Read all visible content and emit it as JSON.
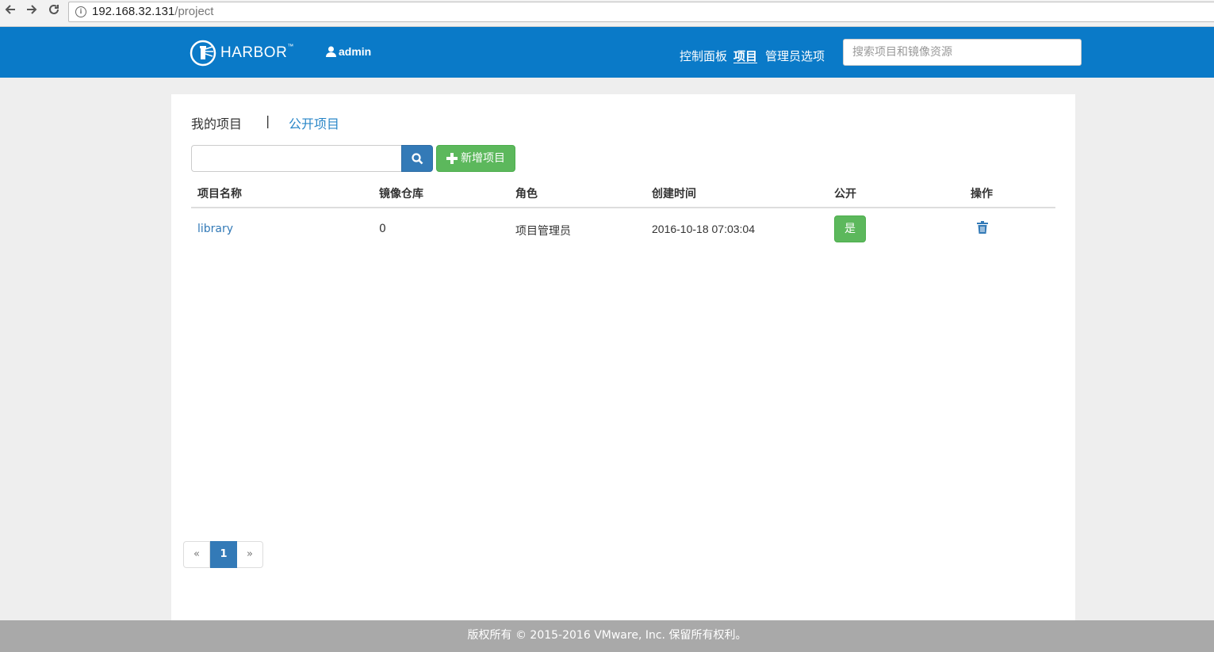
{
  "browser": {
    "url_host": "192.168.32.131",
    "url_path": "/project"
  },
  "header": {
    "brand": "HARBOR",
    "brand_tm": "™",
    "user": "admin",
    "nav": [
      "控制面板",
      "项目",
      "管理员选项"
    ],
    "active_nav": "项目",
    "search_placeholder": "搜索项目和镜像资源",
    "accent_color": "#0a7ac8"
  },
  "tabs": {
    "my_projects": "我的项目",
    "separator": "|",
    "public_projects": "公开项目"
  },
  "toolbar": {
    "search_value": "",
    "add_label": "新增项目"
  },
  "table": {
    "columns": [
      "项目名称",
      "镜像仓库",
      "角色",
      "创建时间",
      "公开",
      "操作"
    ],
    "rows": [
      {
        "name": "library",
        "repos": "0",
        "role": "项目管理员",
        "created": "2016-10-18 07:03:04",
        "public": "是"
      }
    ]
  },
  "pagination": {
    "prev": "«",
    "current": "1",
    "next": "»"
  },
  "footer": {
    "text": "版权所有 © 2015-2016 VMware, Inc. 保留所有权利。"
  }
}
